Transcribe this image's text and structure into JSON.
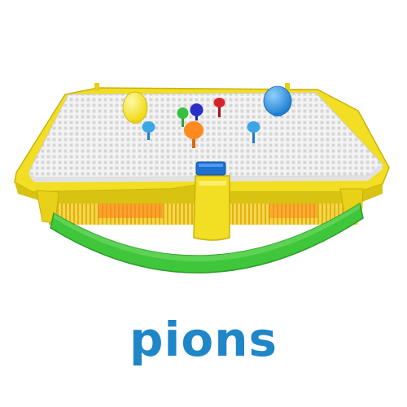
{
  "caption": {
    "text": "pions"
  },
  "colors": {
    "caption": "#1f86c8",
    "tray_yellow": "#f2de22",
    "tray_yellow_dark": "#c9b20a",
    "board_white": "#f4f4f4",
    "rocker_green": "#3fc63a",
    "clip_blue": "#1f6fcf"
  },
  "pegs": [
    {
      "name": "yellow-egg-peg",
      "color": "#f5e52a",
      "shape": "egg"
    },
    {
      "name": "blue-egg-peg",
      "color": "#2f98e0",
      "shape": "egg"
    },
    {
      "name": "orange-peg",
      "color": "#ff8a1f",
      "shape": "mushroom"
    },
    {
      "name": "green-peg",
      "color": "#33c23f",
      "shape": "mushroom"
    },
    {
      "name": "navy-peg",
      "color": "#2a2fc8",
      "shape": "mushroom"
    },
    {
      "name": "red-peg",
      "color": "#d8232a",
      "shape": "mushroom"
    },
    {
      "name": "light-blue-peg-left",
      "color": "#3aa6e6",
      "shape": "mushroom"
    },
    {
      "name": "light-blue-peg-right",
      "color": "#3aa6e6",
      "shape": "mushroom"
    }
  ]
}
